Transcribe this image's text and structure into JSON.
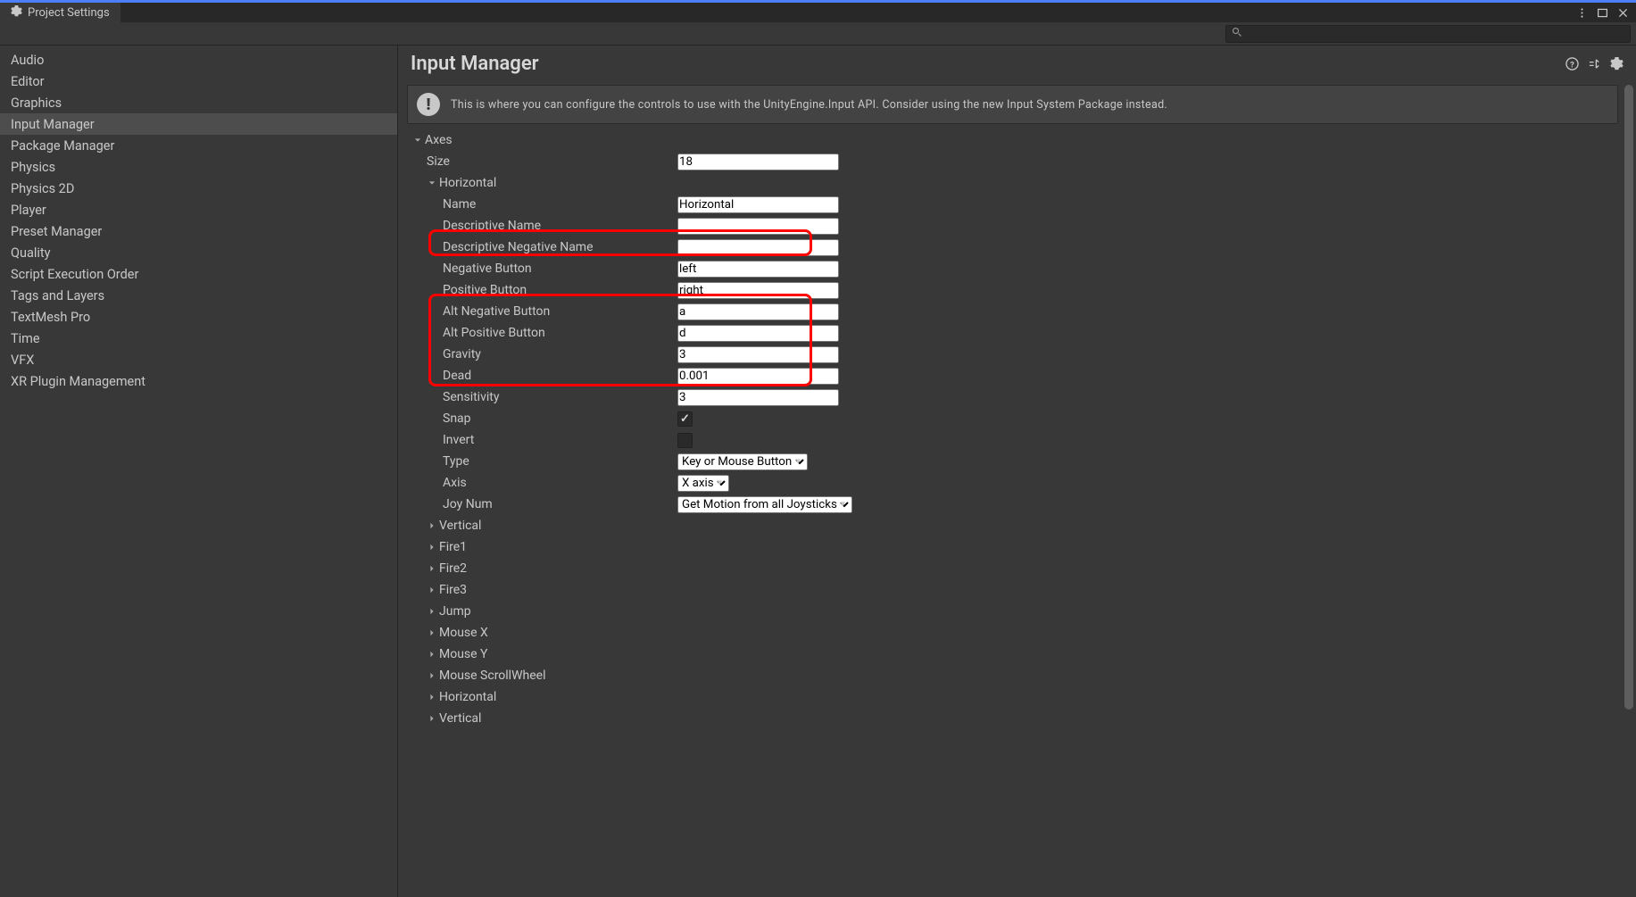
{
  "window": {
    "title": "Project Settings"
  },
  "search": {
    "placeholder": ""
  },
  "sidebar": {
    "items": [
      "Audio",
      "Editor",
      "Graphics",
      "Input Manager",
      "Package Manager",
      "Physics",
      "Physics 2D",
      "Player",
      "Preset Manager",
      "Quality",
      "Script Execution Order",
      "Tags and Layers",
      "TextMesh Pro",
      "Time",
      "VFX",
      "XR Plugin Management"
    ],
    "selected_index": 3
  },
  "main": {
    "title": "Input Manager",
    "info": "This is where you can configure the controls to use with the UnityEngine.Input API. Consider using the new Input System Package instead.",
    "axes_header": "Axes",
    "size_label": "Size",
    "size_value": "18",
    "expanded_axis": {
      "header": "Horizontal",
      "props": {
        "name_label": "Name",
        "name_value": "Horizontal",
        "desc_label": "Descriptive Name",
        "desc_value": "",
        "desc_neg_label": "Descriptive Negative Name",
        "desc_neg_value": "",
        "neg_btn_label": "Negative Button",
        "neg_btn_value": "left",
        "pos_btn_label": "Positive Button",
        "pos_btn_value": "right",
        "alt_neg_label": "Alt Negative Button",
        "alt_neg_value": "a",
        "alt_pos_label": "Alt Positive Button",
        "alt_pos_value": "d",
        "gravity_label": "Gravity",
        "gravity_value": "3",
        "dead_label": "Dead",
        "dead_value": "0.001",
        "sens_label": "Sensitivity",
        "sens_value": "3",
        "snap_label": "Snap",
        "snap_checked": true,
        "invert_label": "Invert",
        "invert_checked": false,
        "type_label": "Type",
        "type_value": "Key or Mouse Button",
        "axis_label": "Axis",
        "axis_value": "X axis",
        "joy_label": "Joy Num",
        "joy_value": "Get Motion from all Joysticks"
      }
    },
    "collapsed_axes": [
      "Vertical",
      "Fire1",
      "Fire2",
      "Fire3",
      "Jump",
      "Mouse X",
      "Mouse Y",
      "Mouse ScrollWheel",
      "Horizontal",
      "Vertical"
    ]
  }
}
